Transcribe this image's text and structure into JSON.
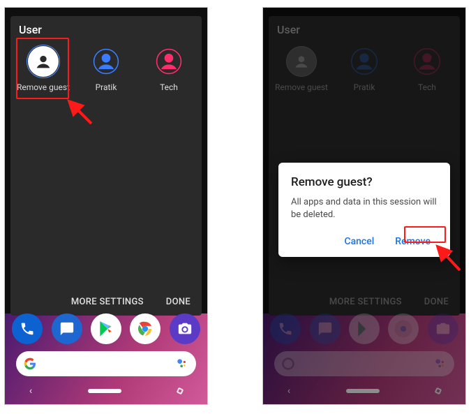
{
  "panel": {
    "title": "User",
    "users": [
      {
        "label": "Remove guest",
        "type": "guest"
      },
      {
        "label": "Pratik",
        "type": "user-blue"
      },
      {
        "label": "Tech",
        "type": "user-pink"
      }
    ],
    "actions": {
      "more_settings": "MORE SETTINGS",
      "done": "DONE"
    }
  },
  "dialog": {
    "title": "Remove guest?",
    "body": "All apps and data in this session will be deleted.",
    "cancel": "Cancel",
    "confirm": "Remove"
  },
  "dock": {
    "phone": "phone-icon",
    "messages": "messages-icon",
    "play": "play-store-icon",
    "chrome": "chrome-icon",
    "camera": "camera-icon"
  },
  "search": {
    "provider": "G",
    "mic": "mic"
  },
  "colors": {
    "guest_bg": "#ffffff",
    "guest_fg": "#2a2a2a",
    "user_blue": "#3a7bff",
    "user_pink": "#ff2d6a",
    "accent": "#1a73e8",
    "highlight": "#ff1a1a"
  }
}
